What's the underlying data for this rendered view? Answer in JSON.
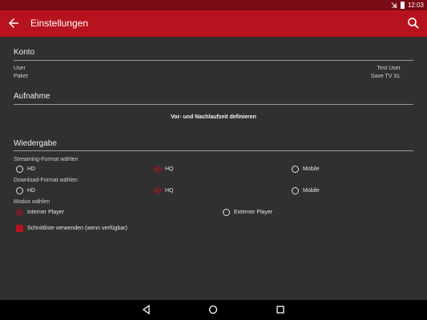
{
  "statusbar": {
    "time": "12:03"
  },
  "appbar": {
    "title": "Einstellungen"
  },
  "konto": {
    "title": "Konto",
    "rows": [
      {
        "label": "User",
        "value": "Test User"
      },
      {
        "label": "Paket",
        "value": "Save TV XL"
      }
    ]
  },
  "aufnahme": {
    "title": "Aufnahme",
    "link": "Vor- und Nachlaufzeit definieren"
  },
  "wiedergabe": {
    "title": "Wiedergabe",
    "streaming": {
      "label": "Streaming-Format wählen",
      "options": [
        "HD",
        "HQ",
        "Mobile"
      ],
      "selected": "HQ"
    },
    "download": {
      "label": "Download-Format wählen",
      "options": [
        "HD",
        "HQ",
        "Mobile"
      ],
      "selected": "HQ"
    },
    "modus": {
      "label": "Modus wählen",
      "options": [
        "Interner Player",
        "Externer Player"
      ],
      "selected": "Interner Player"
    },
    "schnittliste": {
      "label": "Schnittliste verwenden (wenn verfügbar)",
      "checked": true
    }
  },
  "colors": {
    "accent": "#b7131f",
    "statusbar": "#7a0a14",
    "background": "#303030"
  }
}
